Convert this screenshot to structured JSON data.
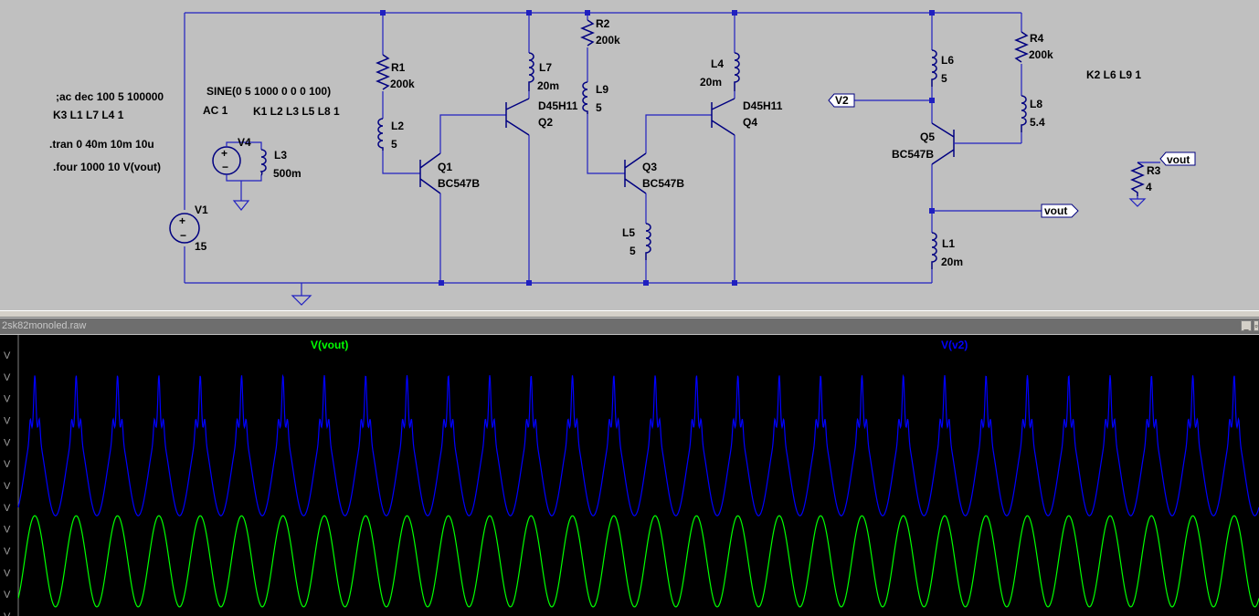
{
  "schematic": {
    "directives": {
      "ac_comment": ";ac dec 100 5 100000",
      "k3": "K3  L1  L7  L4 1",
      "tran": ".tran 0 40m 10m 10u",
      "four": ".four 1000 10 V(vout)",
      "sine": "SINE(0 5 1000 0 0 0 100)",
      "ac": "AC 1",
      "k1": "K1  L2  L3  L5  L8  1",
      "k2": "K2  L6  L9  1"
    },
    "components": [
      {
        "ref": "V1",
        "value": "15"
      },
      {
        "ref": "V4",
        "value": ""
      },
      {
        "ref": "L3",
        "value": "500m"
      },
      {
        "ref": "R1",
        "value": "200k"
      },
      {
        "ref": "L2",
        "value": "5"
      },
      {
        "ref": "Q1",
        "value": "BC547B"
      },
      {
        "ref": "L7",
        "value": "20m"
      },
      {
        "ref": "Q2",
        "value": "D45H11"
      },
      {
        "ref": "R2",
        "value": "200k"
      },
      {
        "ref": "L9",
        "value": "5"
      },
      {
        "ref": "Q3",
        "value": "BC547B"
      },
      {
        "ref": "L5",
        "value": "5"
      },
      {
        "ref": "L4",
        "value": "20m"
      },
      {
        "ref": "Q4",
        "value": "D45H11"
      },
      {
        "ref": "L6",
        "value": "5"
      },
      {
        "ref": "Q5",
        "value": "BC547B"
      },
      {
        "ref": "L1",
        "value": "20m"
      },
      {
        "ref": "R4",
        "value": "200k"
      },
      {
        "ref": "L8",
        "value": "5.4"
      },
      {
        "ref": "R3",
        "value": "4"
      }
    ],
    "net_labels": {
      "v2": "V2",
      "vout": "vout",
      "vout2": "vout"
    }
  },
  "waveform_window": {
    "title": "2sk82monoled.raw",
    "minimize_label": "_",
    "maximize_label": "▫"
  },
  "chart_data": {
    "type": "line",
    "series": [
      {
        "name": "V(vout)",
        "color": "#00ff00",
        "shape": "sine",
        "cycles_visible": 30,
        "min_norm": 0.0,
        "max_norm": 0.37
      },
      {
        "name": "V(v2)",
        "color": "#0000ff",
        "shape": "sine-with-spikes",
        "cycles_visible": 30,
        "min_norm": 0.37,
        "max_norm": 0.97
      }
    ],
    "ytick_labels": [
      "V",
      "V",
      "V",
      "V",
      "V",
      "V",
      "V",
      "V",
      "V",
      "V",
      "V",
      "V",
      "V"
    ],
    "grid": false,
    "background": "#000000"
  }
}
